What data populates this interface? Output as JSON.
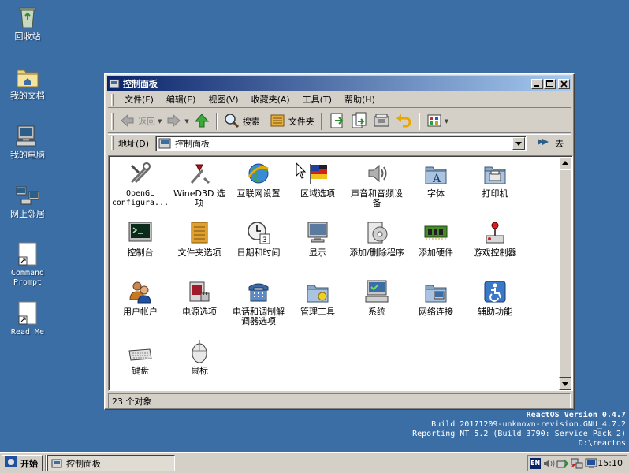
{
  "desktop": {
    "icons": [
      {
        "label": "回收站",
        "icon": "recycle-bin-icon"
      },
      {
        "label": "我的文档",
        "icon": "my-documents-icon"
      },
      {
        "label": "我的电脑",
        "icon": "my-computer-icon"
      },
      {
        "label": "网上邻居",
        "icon": "network-places-icon"
      },
      {
        "label": "Command Prompt",
        "icon": "shortcut-icon"
      },
      {
        "label": "Read Me",
        "icon": "shortcut-icon"
      }
    ],
    "build_info": [
      "ReactOS Version 0.4.7",
      "Build 20171209-unknown-revision.GNU_4.7.2",
      "Reporting NT 5.2 (Build 3790: Service Pack 2)",
      "D:\\reactos"
    ]
  },
  "window": {
    "title": "控制面板",
    "menu": [
      "文件(F)",
      "编辑(E)",
      "视图(V)",
      "收藏夹(A)",
      "工具(T)",
      "帮助(H)"
    ],
    "toolbar": {
      "back": "返回",
      "search": "搜索",
      "folders": "文件夹"
    },
    "address": {
      "label": "地址(D)",
      "value": "控制面板",
      "go": "去"
    },
    "applets": [
      {
        "label": "OpenGL configura...",
        "icon": "opengl-icon"
      },
      {
        "label": "WineD3D 选项",
        "icon": "wined3d-icon"
      },
      {
        "label": "互联网设置",
        "icon": "internet-settings-icon"
      },
      {
        "label": "区域选项",
        "icon": "regional-options-icon"
      },
      {
        "label": "声音和音频设备",
        "icon": "sound-icon"
      },
      {
        "label": "字体",
        "icon": "fonts-icon"
      },
      {
        "label": "打印机",
        "icon": "printer-icon"
      },
      {
        "label": "控制台",
        "icon": "console-icon"
      },
      {
        "label": "文件夹选项",
        "icon": "folder-options-icon"
      },
      {
        "label": "日期和时间",
        "icon": "date-time-icon"
      },
      {
        "label": "显示",
        "icon": "display-icon"
      },
      {
        "label": "添加/删除程序",
        "icon": "add-remove-programs-icon"
      },
      {
        "label": "添加硬件",
        "icon": "add-hardware-icon"
      },
      {
        "label": "游戏控制器",
        "icon": "game-controller-icon"
      },
      {
        "label": "用户帐户",
        "icon": "user-accounts-icon"
      },
      {
        "label": "电源选项",
        "icon": "power-options-icon"
      },
      {
        "label": "电话和调制解调器选项",
        "icon": "phone-modem-icon"
      },
      {
        "label": "管理工具",
        "icon": "admin-tools-icon"
      },
      {
        "label": "系统",
        "icon": "system-icon"
      },
      {
        "label": "网络连接",
        "icon": "network-connections-icon"
      },
      {
        "label": "辅助功能",
        "icon": "accessibility-icon"
      },
      {
        "label": "键盘",
        "icon": "keyboard-icon"
      },
      {
        "label": "鼠标",
        "icon": "mouse-icon"
      }
    ],
    "status": "23 个对象"
  },
  "taskbar": {
    "start": "开始",
    "task": "控制面板",
    "lang": "EN",
    "clock": "15:10"
  }
}
